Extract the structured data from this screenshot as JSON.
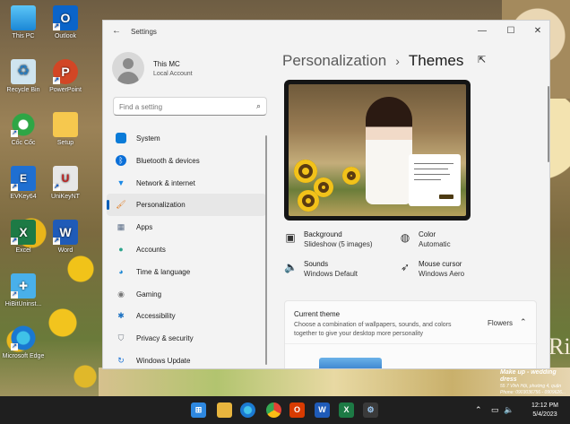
{
  "desktop": {
    "icons": [
      {
        "label": "This PC"
      },
      {
        "label": "Outlook"
      },
      {
        "label": "Recycle Bin"
      },
      {
        "label": "PowerPoint"
      },
      {
        "label": "Cốc Cốc"
      },
      {
        "label": "Setup"
      },
      {
        "label": "EVKey64"
      },
      {
        "label": "UniKeyNT"
      },
      {
        "label": "Excel"
      },
      {
        "label": "Word"
      },
      {
        "label": "HiBitUninst..."
      },
      {
        "label": "Microsoft Edge"
      }
    ],
    "watermark": {
      "title": "Make up - wedding dress",
      "line1": "55 7 Vĩnh Hội, phường 4, quận",
      "line2": "Phone: 0903036756 - 0909626..."
    }
  },
  "settings": {
    "window_title": "Settings",
    "user": {
      "name": "This MC",
      "account": "Local Account"
    },
    "search": {
      "placeholder": "Find a setting"
    },
    "nav": [
      {
        "label": "System",
        "icon": "system-icon",
        "color": "#0a7bd8"
      },
      {
        "label": "Bluetooth & devices",
        "icon": "bluetooth-icon",
        "color": "#0a6fd8"
      },
      {
        "label": "Network & internet",
        "icon": "wifi-icon",
        "color": "#1c8ae6"
      },
      {
        "label": "Personalization",
        "icon": "brush-icon",
        "color": "#e07b20"
      },
      {
        "label": "Apps",
        "icon": "apps-icon",
        "color": "#5a6c86"
      },
      {
        "label": "Accounts",
        "icon": "accounts-icon",
        "color": "#2ca58d"
      },
      {
        "label": "Time & language",
        "icon": "globe-clock-icon",
        "color": "#1e88d4"
      },
      {
        "label": "Gaming",
        "icon": "gamepad-icon",
        "color": "#777777"
      },
      {
        "label": "Accessibility",
        "icon": "accessibility-icon",
        "color": "#1d72c2"
      },
      {
        "label": "Privacy & security",
        "icon": "shield-icon",
        "color": "#6f7780"
      },
      {
        "label": "Windows Update",
        "icon": "update-icon",
        "color": "#1e74d6"
      }
    ],
    "active_nav": "Personalization",
    "breadcrumb": {
      "parent": "Personalization",
      "separator": "›",
      "current": "Themes"
    },
    "props": {
      "background": {
        "title": "Background",
        "value": "Slideshow (5 images)"
      },
      "color": {
        "title": "Color",
        "value": "Automatic"
      },
      "sounds": {
        "title": "Sounds",
        "value": "Windows Default"
      },
      "cursor": {
        "title": "Mouse cursor",
        "value": "Windows Aero"
      }
    },
    "current_theme": {
      "title": "Current theme",
      "description": "Choose a combination of wallpapers, sounds, and colors together to give your desktop more personality",
      "value": "Flowers"
    }
  },
  "taskbar": {
    "apps": [
      "start-icon",
      "search-icon",
      "file-explorer-icon",
      "edge-icon",
      "google-chrome-icon",
      "office-icon",
      "word-icon",
      "excel-icon",
      "settings-icon"
    ],
    "clock": {
      "time": "12:12 PM",
      "date": "5/4/2023"
    }
  }
}
